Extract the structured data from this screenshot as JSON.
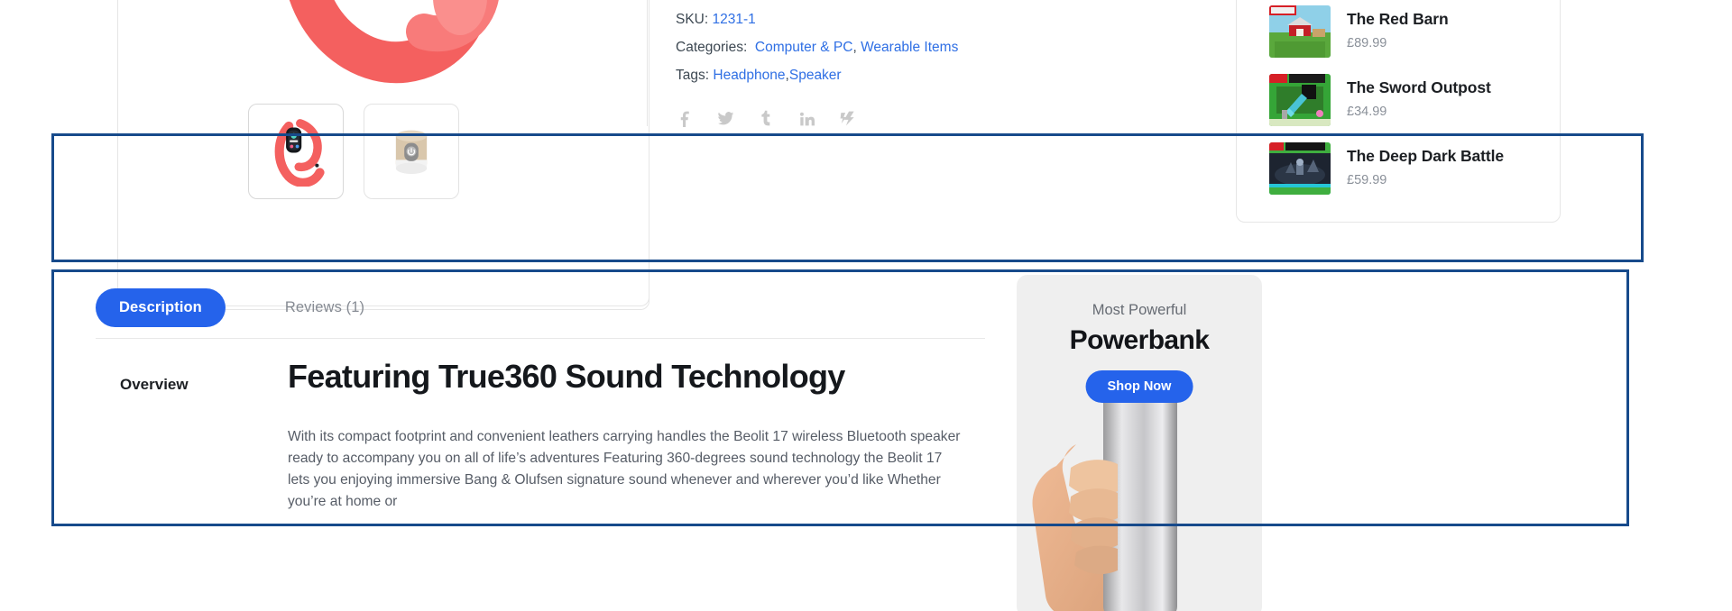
{
  "product_meta": {
    "sku_label": "SKU:",
    "sku_value": "1231-1",
    "categories_label": "Categories:",
    "categories": [
      "Computer & PC",
      "Wearable Items"
    ],
    "categories_separator": ", ",
    "tags_label": "Tags:",
    "tags": [
      "Headphone",
      "Speaker"
    ],
    "tags_separator": ","
  },
  "social": {
    "items": [
      "facebook-icon",
      "twitter-icon",
      "tumblr-icon",
      "linkedin-icon",
      "flickr-icon"
    ]
  },
  "gallery": {
    "thumbs": [
      {
        "name": "fitness-band-thumbnail"
      },
      {
        "name": "smart-speaker-thumbnail"
      }
    ]
  },
  "related_products": {
    "items": [
      {
        "name": "The Red Barn",
        "price": "£89.99"
      },
      {
        "name": "The Sword Outpost",
        "price": "£34.99"
      },
      {
        "name": "The Deep Dark Battle",
        "price": "£59.99"
      }
    ]
  },
  "tabs": {
    "items": [
      {
        "label": "Description",
        "active": true
      },
      {
        "label": "Reviews (1)",
        "active": false
      }
    ]
  },
  "description": {
    "section_label": "Overview",
    "heading": "Featuring True360 Sound Technology",
    "body": "With its compact footprint and convenient leathers carrying handles the Beolit 17 wireless Bluetooth speaker ready to accompany you on all of life’s adventures Featuring 360-degrees sound technology the Beolit 17 lets you enjoying immersive Bang & Olufsen signature sound whenever and wherever you’d like Whether you’re at home or"
  },
  "promo": {
    "kicker": "Most Powerful",
    "title": "Powerbank",
    "button": "Shop Now"
  },
  "colors": {
    "accent_blue": "#2563eb",
    "link_blue": "#2f6fe4",
    "annotation_blue": "#174a8b",
    "product_coral": "#f4605f",
    "muted_text": "#8a9099"
  }
}
